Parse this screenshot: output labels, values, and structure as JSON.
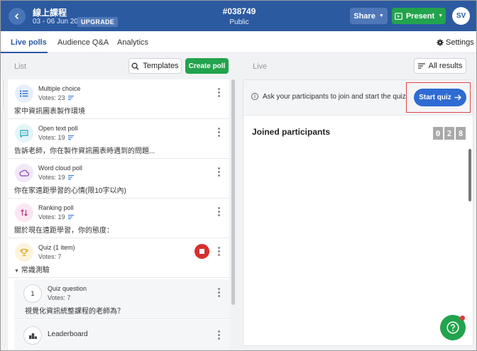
{
  "header": {
    "event_title": "線上課程",
    "event_dates": "03 - 06 Jun 2021",
    "upgrade_label": "UPGRADE",
    "event_code": "#038749",
    "visibility": "Public",
    "share_label": "Share",
    "present_label": "Present",
    "avatar_initials": "SV"
  },
  "tabs": {
    "items": [
      "Live polls",
      "Audience Q&A",
      "Analytics"
    ],
    "active": "Live polls",
    "settings_label": "Settings"
  },
  "left": {
    "list_label": "List",
    "templates_label": "Templates",
    "create_poll_label": "Create poll",
    "polls": [
      {
        "type": "Multiple choice",
        "votes": "Votes: 23",
        "question": "家中資訊圖表製作環境",
        "icon": "list-icon",
        "icon_color": "#2c6fd1",
        "icon_bg": "#e7effb"
      },
      {
        "type": "Open text poll",
        "votes": "Votes: 19",
        "question": "告訴老師，你在製作資訊圖表時遇到的問題...",
        "icon": "chat-bubble-icon",
        "icon_color": "#1aa3b8",
        "icon_bg": "#e3f5f8"
      },
      {
        "type": "Word cloud poll",
        "votes": "Votes: 19",
        "question": "你在家遠距學習的心情(限10字以內)",
        "icon": "cloud-icon",
        "icon_color": "#8a3fb8",
        "icon_bg": "#f2e8f8"
      },
      {
        "type": "Ranking poll",
        "votes": "Votes: 19",
        "question": "關於現在遠距學習，你的態度：",
        "icon": "sort-arrows-icon",
        "icon_color": "#c2357a",
        "icon_bg": "#fbe7f1"
      },
      {
        "type": "Quiz (1 item)",
        "votes": "Votes: 7",
        "question": "常識測驗",
        "icon": "trophy-icon",
        "icon_color": "#e0a21b",
        "icon_bg": "#fdf3dc"
      }
    ],
    "quiz_question": {
      "number": "1",
      "type": "Quiz question",
      "votes": "Votes: 7",
      "question": "視覺化資訊統整課程的老師為？"
    },
    "leaderboard_label": "Leaderboard"
  },
  "right": {
    "live_label": "Live",
    "all_results_label": "All results",
    "info_text": "Ask your participants to join and start the quiz",
    "start_quiz_label": "Start quiz",
    "joined_title": "Joined participants",
    "counter_digits": [
      "0",
      "2",
      "8"
    ]
  },
  "colors": {
    "brand_blue": "#2c5aa0",
    "green": "#22a34d",
    "start_quiz_blue": "#2f6bd2",
    "stop_red": "#d92e2e",
    "highlight_outline": "#e04545"
  }
}
